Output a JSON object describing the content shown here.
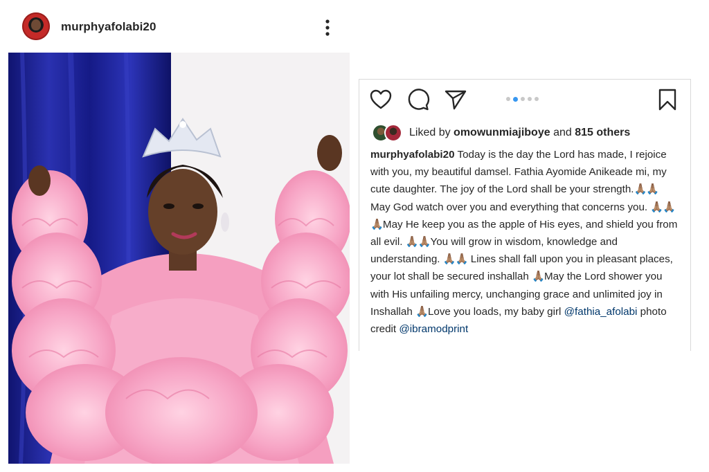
{
  "post": {
    "username": "murphyafolabi20",
    "more_icon": "more-vertical-icon"
  },
  "actions": {
    "like_icon": "heart-icon",
    "comment_icon": "comment-icon",
    "share_icon": "send-icon",
    "save_icon": "bookmark-icon",
    "carousel_total": 5,
    "carousel_active": 2
  },
  "likes": {
    "prefix": "Liked by",
    "user": "omowunmiajiboye",
    "conjunction": "and",
    "others": "815 others"
  },
  "caption": {
    "user": "murphyafolabi20",
    "seg1": " Today is the day the Lord has made, I rejoice with you, my beautiful damsel. Fathia Ayomide Anikeade mi, my cute daughter. The joy of the Lord shall be your strength.",
    "pray1": "🙏🏽🙏🏽",
    "seg2": " May God watch over you and everything that concerns you. ",
    "pray2": "🙏🏽🙏🏽🙏🏽",
    "seg3": "May He keep you as the apple of His eyes, and shield you from all evil. ",
    "pray3": "🙏🏽🙏🏽",
    "seg4": "You will grow in wisdom, knowledge and understanding. ",
    "pray4": "🙏🏽🙏🏽",
    "seg5": " Lines shall fall upon you in pleasant places, your lot shall be secured inshallah ",
    "pray5": "🙏🏽",
    "seg6": "May the Lord shower you with His unfailing mercy, unchanging grace and unlimited joy in Inshallah ",
    "pray6": "🙏🏽",
    "seg7": "Love you loads, my baby girl ",
    "mention1": "@fathia_afolabi",
    "seg8": " photo credit ",
    "mention2": "@ibramodprint"
  },
  "colors": {
    "link": "#00376b",
    "carousel_active": "#3897f0",
    "curtain": "#1a1f8c",
    "dress": "#f59fc0"
  }
}
